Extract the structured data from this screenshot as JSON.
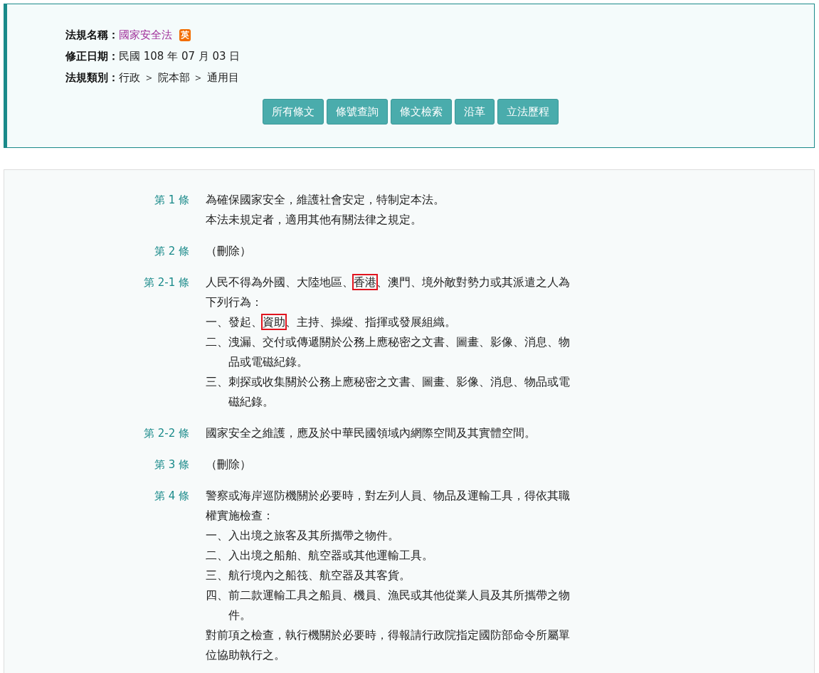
{
  "law_info": {
    "fields": [
      {
        "label": "法規名稱：",
        "value": "國家安全法",
        "kind": "link",
        "badge": "英"
      },
      {
        "label": "修正日期：",
        "value": "民國 108 年 07 月 03 日",
        "kind": "text"
      },
      {
        "label": "法規類別：",
        "value": "行政 ＞ 院本部 ＞ 通用目",
        "kind": "text"
      }
    ],
    "buttons": [
      "所有條文",
      "條號查詢",
      "條文檢索",
      "沿革",
      "立法歷程"
    ]
  },
  "articles": [
    {
      "number": "第 1 條",
      "paragraphs": [
        {
          "kind": "text",
          "text": "為確保國家安全，維護社會安定，特制定本法。"
        },
        {
          "kind": "text",
          "text": "本法未規定者，適用其他有關法律之規定。"
        }
      ]
    },
    {
      "number": "第 2 條",
      "paragraphs": [
        {
          "kind": "text",
          "text": "（刪除）"
        }
      ]
    },
    {
      "number": "第 2-1 條",
      "paragraphs": [
        {
          "kind": "text",
          "segments": [
            {
              "text": "人民不得為外國、大陸地區、",
              "marked": false
            },
            {
              "text": "香港",
              "marked": true
            },
            {
              "text": "、澳門、境外敵對勢力或其派遣之人為下列行為：",
              "marked": false
            }
          ]
        },
        {
          "kind": "item",
          "segments": [
            {
              "text": "一、發起、",
              "marked": false
            },
            {
              "text": "資助",
              "marked": true
            },
            {
              "text": "、主持、操縱、指揮或發展組織。",
              "marked": false
            }
          ]
        },
        {
          "kind": "item",
          "text": "二、洩漏、交付或傳遞關於公務上應秘密之文書、圖畫、影像、消息、物品或電磁紀錄。"
        },
        {
          "kind": "item",
          "text": "三、刺探或收集關於公務上應秘密之文書、圖畫、影像、消息、物品或電磁紀錄。"
        }
      ]
    },
    {
      "number": "第 2-2 條",
      "paragraphs": [
        {
          "kind": "text",
          "text": "國家安全之維護，應及於中華民國領域內網際空間及其實體空間。"
        }
      ]
    },
    {
      "number": "第 3 條",
      "paragraphs": [
        {
          "kind": "text",
          "text": "（刪除）"
        }
      ]
    },
    {
      "number": "第 4 條",
      "paragraphs": [
        {
          "kind": "text",
          "text": "警察或海岸巡防機關於必要時，對左列人員、物品及運輸工具，得依其職權實施檢查："
        },
        {
          "kind": "item",
          "text": "一、入出境之旅客及其所攜帶之物件。"
        },
        {
          "kind": "item",
          "text": "二、入出境之船舶、航空器或其他運輸工具。"
        },
        {
          "kind": "item",
          "text": "三、航行境內之船筏、航空器及其客貨。"
        },
        {
          "kind": "item",
          "text": "四、前二款運輸工具之船員、機員、漁民或其他從業人員及其所攜帶之物件。"
        },
        {
          "kind": "text",
          "text": "對前項之檢查，執行機關於必要時，得報請行政院指定國防部命令所屬單位協助執行之。"
        }
      ]
    }
  ]
}
